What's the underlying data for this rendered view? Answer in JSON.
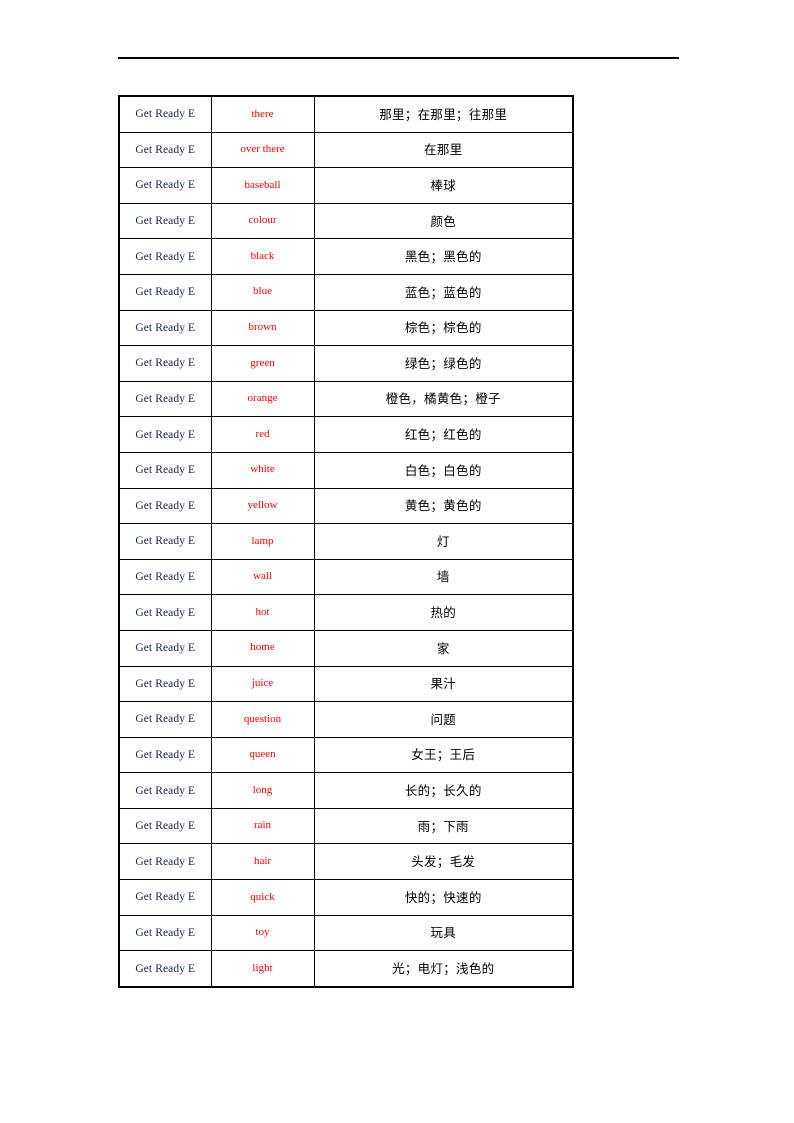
{
  "page": {
    "header_rule": "horizontal-rule",
    "background_color": "#ffffff"
  },
  "colors": {
    "word_red": "#ff0000",
    "unit_text": "#17244a",
    "meaning_text": "#000000",
    "border": "#000000"
  },
  "table": {
    "name": "vocabulary-table",
    "columns": [
      "unit",
      "word",
      "meaning"
    ],
    "thick_divider_after_row": 14,
    "rows": [
      {
        "unit": "Get Ready E",
        "word": "there",
        "meaning": "那里；在那里；往那里"
      },
      {
        "unit": "Get Ready E",
        "word": "over there",
        "meaning": "在那里"
      },
      {
        "unit": "Get Ready E",
        "word": "baseball",
        "meaning": "棒球"
      },
      {
        "unit": "Get Ready E",
        "word": "colour",
        "meaning": "颜色"
      },
      {
        "unit": "Get Ready E",
        "word": "black",
        "meaning": "黑色；黑色的"
      },
      {
        "unit": "Get Ready E",
        "word": "blue",
        "meaning": "蓝色；蓝色的"
      },
      {
        "unit": "Get Ready E",
        "word": "brown",
        "meaning": "棕色；棕色的"
      },
      {
        "unit": "Get Ready E",
        "word": "green",
        "meaning": "绿色；绿色的"
      },
      {
        "unit": "Get Ready E",
        "word": "orange",
        "meaning": "橙色，橘黄色；橙子"
      },
      {
        "unit": "Get Ready E",
        "word": "red",
        "meaning": "红色；红色的"
      },
      {
        "unit": "Get Ready E",
        "word": "white",
        "meaning": "白色；白色的"
      },
      {
        "unit": "Get Ready E",
        "word": "yellow",
        "meaning": "黄色；黄色的"
      },
      {
        "unit": "Get Ready E",
        "word": "lamp",
        "meaning": "灯"
      },
      {
        "unit": "Get Ready E",
        "word": "wall",
        "meaning": "墙"
      },
      {
        "unit": "Get Ready E",
        "word": "hot",
        "meaning": "热的"
      },
      {
        "unit": "Get Ready E",
        "word": "home",
        "meaning": "家"
      },
      {
        "unit": "Get Ready E",
        "word": "juice",
        "meaning": "果汁"
      },
      {
        "unit": "Get Ready E",
        "word": "question",
        "meaning": "问题"
      },
      {
        "unit": "Get Ready E",
        "word": "queen",
        "meaning": "女王；王后"
      },
      {
        "unit": "Get Ready E",
        "word": "long",
        "meaning": "长的；长久的"
      },
      {
        "unit": "Get Ready E",
        "word": "rain",
        "meaning": "雨；下雨"
      },
      {
        "unit": "Get Ready E",
        "word": "hair",
        "meaning": "头发；毛发"
      },
      {
        "unit": "Get Ready E",
        "word": "quick",
        "meaning": "快的；快速的"
      },
      {
        "unit": "Get Ready E",
        "word": "toy",
        "meaning": "玩具"
      },
      {
        "unit": "Get Ready E",
        "word": "light",
        "meaning": "光；电灯；浅色的"
      }
    ]
  }
}
